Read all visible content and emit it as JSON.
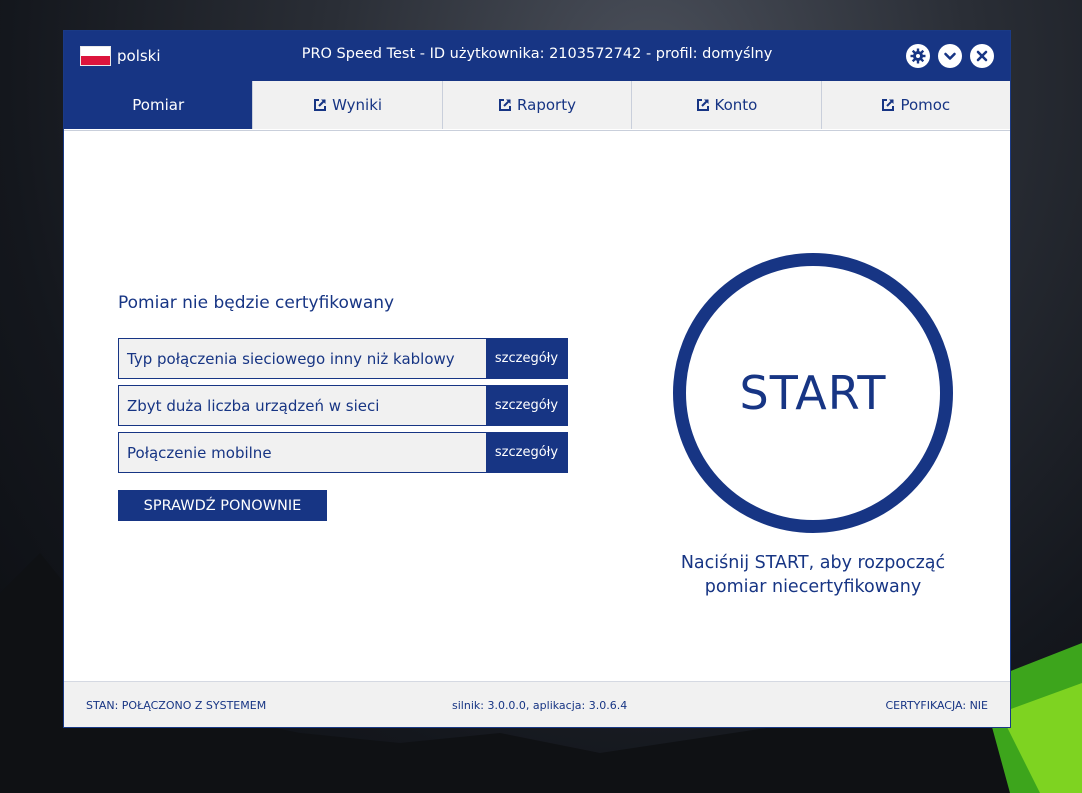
{
  "titlebar": {
    "language": "polski",
    "title": "PRO Speed Test - ID użytkownika: 2103572742 - profil: domyślny",
    "buttons": [
      "gear-icon",
      "chevron-down-icon",
      "close-icon"
    ]
  },
  "tabs": [
    {
      "label": "Pomiar",
      "active": true
    },
    {
      "label": "Wyniki",
      "icon": "external-link-icon"
    },
    {
      "label": "Raporty",
      "icon": "external-link-icon"
    },
    {
      "label": "Konto",
      "icon": "external-link-icon"
    },
    {
      "label": "Pomoc",
      "icon": "external-link-icon"
    }
  ],
  "main": {
    "warning_title": "Pomiar nie będzie certyfikowany",
    "issues": [
      {
        "text": "Typ połączenia sieciowego inny niż kablowy",
        "details": "szczegóły"
      },
      {
        "text": "Zbyt duża liczba urządzeń w sieci",
        "details": "szczegóły"
      },
      {
        "text": "Połączenie mobilne",
        "details": "szczegóły"
      }
    ],
    "recheck_label": "SPRAWDŹ PONOWNIE",
    "start_label": "START",
    "hint_line1": "Naciśnij START, aby rozpocząć",
    "hint_line2": "pomiar niecertyfikowany"
  },
  "status": {
    "state": "STAN: POŁĄCZONO Z SYSTEMEM",
    "version": "silnik: 3.0.0.0, aplikacja: 3.0.6.4",
    "certification": "CERTYFIKACJA: NIE"
  },
  "colors": {
    "accent": "#173584",
    "panel": "#f1f1f1",
    "flag_red": "#dc143c"
  }
}
